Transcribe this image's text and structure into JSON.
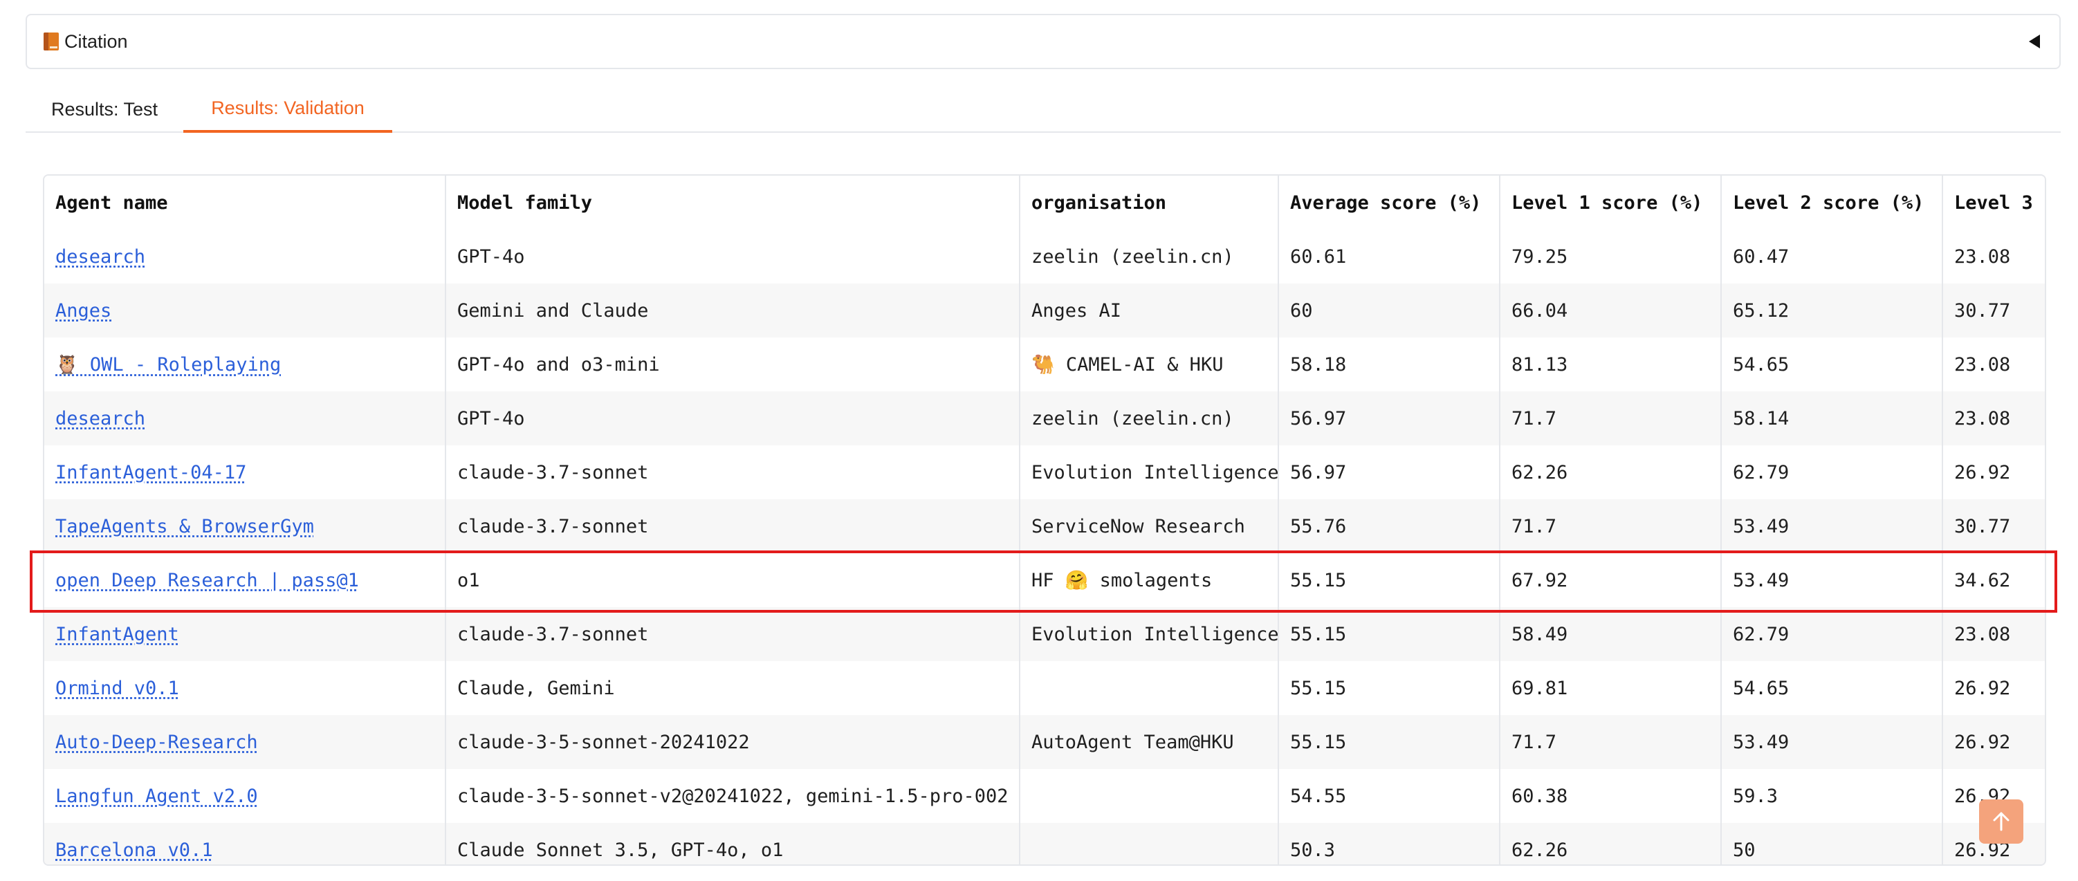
{
  "citation": {
    "icon": "book-icon",
    "label": "Citation"
  },
  "tabs": [
    {
      "label": "Results: Test",
      "active": false
    },
    {
      "label": "Results: Validation",
      "active": true
    }
  ],
  "table": {
    "columns": [
      "Agent name",
      "Model family",
      "organisation",
      "Average score (%)",
      "Level 1 score (%)",
      "Level 2 score (%)",
      "Level 3"
    ],
    "rows": [
      {
        "agent": "desearch",
        "model": "GPT-4o",
        "org": "zeelin (zeelin.cn)",
        "avg": "60.61",
        "l1": "79.25",
        "l2": "60.47",
        "l3": "23.08"
      },
      {
        "agent": "Anges",
        "model": "Gemini and Claude",
        "org": "Anges AI",
        "avg": "60",
        "l1": "66.04",
        "l2": "65.12",
        "l3": "30.77"
      },
      {
        "agent": "🦉 OWL - Roleplaying",
        "model": "GPT-4o and o3-mini",
        "org": "🐫 CAMEL-AI & HKU",
        "avg": "58.18",
        "l1": "81.13",
        "l2": "54.65",
        "l3": "23.08"
      },
      {
        "agent": "desearch",
        "model": "GPT-4o",
        "org": "zeelin (zeelin.cn)",
        "avg": "56.97",
        "l1": "71.7",
        "l2": "58.14",
        "l3": "23.08"
      },
      {
        "agent": "InfantAgent-04-17",
        "model": "claude-3.7-sonnet",
        "org": "Evolution Intelligence",
        "avg": "56.97",
        "l1": "62.26",
        "l2": "62.79",
        "l3": "26.92"
      },
      {
        "agent": "TapeAgents & BrowserGym",
        "model": "claude-3.7-sonnet",
        "org": "ServiceNow Research",
        "avg": "55.76",
        "l1": "71.7",
        "l2": "53.49",
        "l3": "30.77"
      },
      {
        "agent": "open Deep Research | pass@1",
        "model": "o1",
        "org": "HF 🤗 smolagents",
        "avg": "55.15",
        "l1": "67.92",
        "l2": "53.49",
        "l3": "34.62"
      },
      {
        "agent": "InfantAgent",
        "model": "claude-3.7-sonnet",
        "org": "Evolution Intelligence",
        "avg": "55.15",
        "l1": "58.49",
        "l2": "62.79",
        "l3": "23.08"
      },
      {
        "agent": "Ormind v0.1",
        "model": "Claude, Gemini",
        "org": "",
        "avg": "55.15",
        "l1": "69.81",
        "l2": "54.65",
        "l3": "26.92"
      },
      {
        "agent": "Auto-Deep-Research",
        "model": "claude-3-5-sonnet-20241022",
        "org": "AutoAgent Team@HKU",
        "avg": "55.15",
        "l1": "71.7",
        "l2": "53.49",
        "l3": "26.92"
      },
      {
        "agent": "Langfun Agent v2.0",
        "model": "claude-3-5-sonnet-v2@20241022, gemini-1.5-pro-002",
        "org": "",
        "avg": "54.55",
        "l1": "60.38",
        "l2": "59.3",
        "l3": "26.92"
      },
      {
        "agent": "Barcelona v0.1",
        "model": "Claude Sonnet 3.5, GPT-4o, o1",
        "org": "",
        "avg": "50.3",
        "l1": "62.26",
        "l2": "50",
        "l3": "26.92"
      }
    ]
  },
  "scroll_top": {
    "icon": "arrow-up-icon"
  },
  "colors": {
    "accent": "#f26522",
    "link": "#2b5fd9",
    "highlight": "#e31b1b",
    "scroll_button": "#f4a37c"
  }
}
